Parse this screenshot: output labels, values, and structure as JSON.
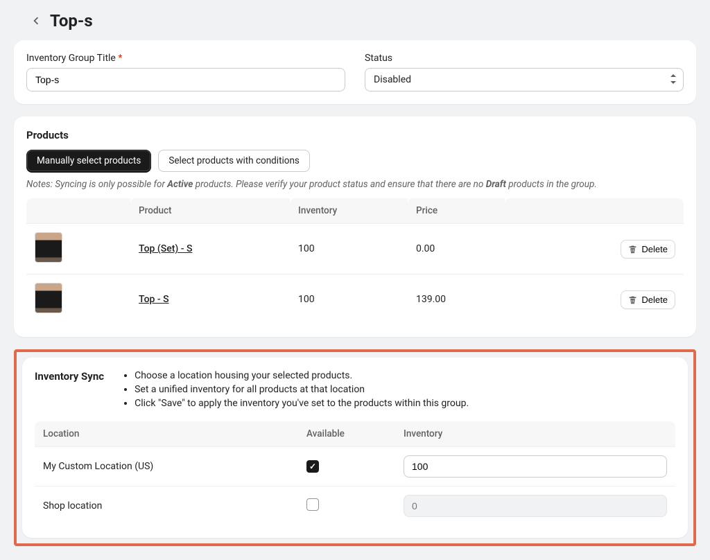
{
  "header": {
    "title": "Top-s"
  },
  "group": {
    "title_label": "Inventory Group Title",
    "title_value": "Top-s",
    "status_label": "Status",
    "status_value": "Disabled"
  },
  "products": {
    "section_title": "Products",
    "tabs": {
      "manual": "Manually select products",
      "conditions": "Select products with conditions"
    },
    "notes": {
      "pre": "Notes: Syncing is only possible for ",
      "active": "Active",
      "mid": " products. Please verify your product status and ensure that there are no ",
      "draft": "Draft",
      "post": " products in the group."
    },
    "columns": {
      "product": "Product",
      "inventory": "Inventory",
      "price": "Price"
    },
    "items": [
      {
        "name": "Top (Set) - S",
        "inventory": "100",
        "price": "0.00",
        "delete": "Delete"
      },
      {
        "name": "Top - S",
        "inventory": "100",
        "price": "139.00",
        "delete": "Delete"
      }
    ]
  },
  "sync": {
    "title": "Inventory Sync",
    "bullets": [
      "Choose a location housing your selected products.",
      "Set a unified inventory for all products at that location",
      "Click \"Save\" to apply the inventory you've set to the products within this group."
    ],
    "columns": {
      "location": "Location",
      "available": "Available",
      "inventory": "Inventory"
    },
    "rows": [
      {
        "location": "My Custom Location (US)",
        "checked": true,
        "inventory": "100"
      },
      {
        "location": "Shop location",
        "checked": false,
        "inventory": "",
        "placeholder": "0"
      }
    ]
  }
}
